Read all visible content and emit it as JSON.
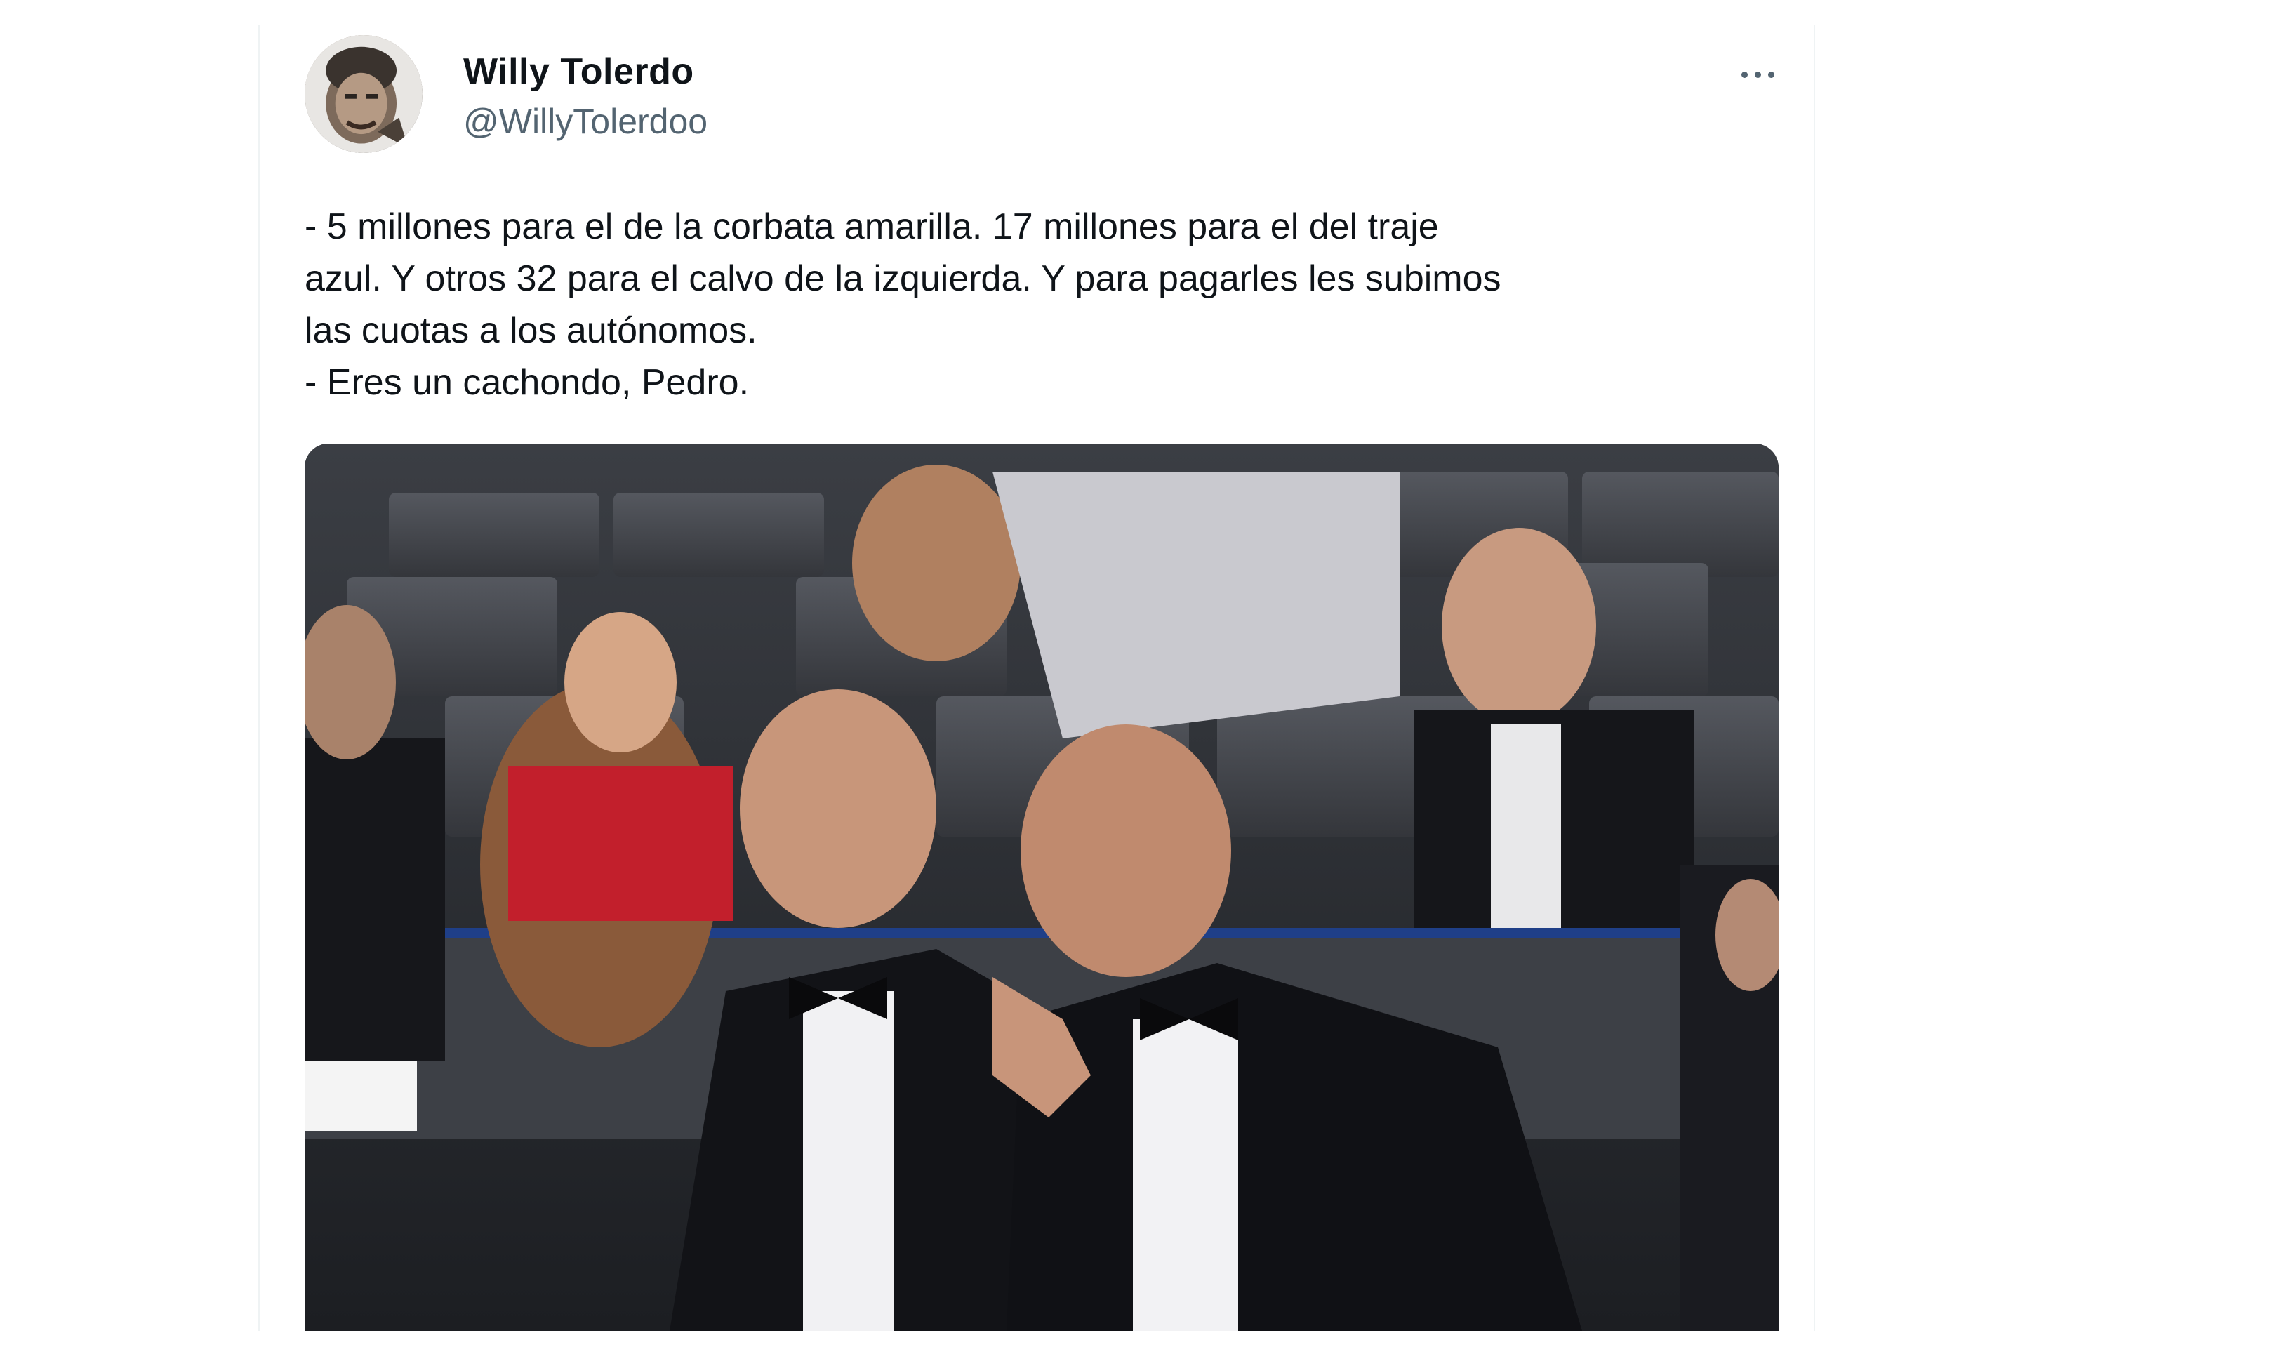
{
  "tweet": {
    "author_name": "Willy Tolerdo",
    "author_handle": "@WillyTolerdoo",
    "more_icon": "more-horizontal-icon",
    "text_lines": [
      "- 5 millones para el de la corbata amarilla. 17 millones para el del traje",
      "azul. Y otros 32 para el calvo de la izquierda. Y para pagarles les subimos",
      "las cuotas a los autónomos.",
      "- Eres un cachondo, Pedro."
    ]
  },
  "colors": {
    "text_primary": "#0f1419",
    "text_secondary": "#536471",
    "border": "#eff3f4"
  }
}
